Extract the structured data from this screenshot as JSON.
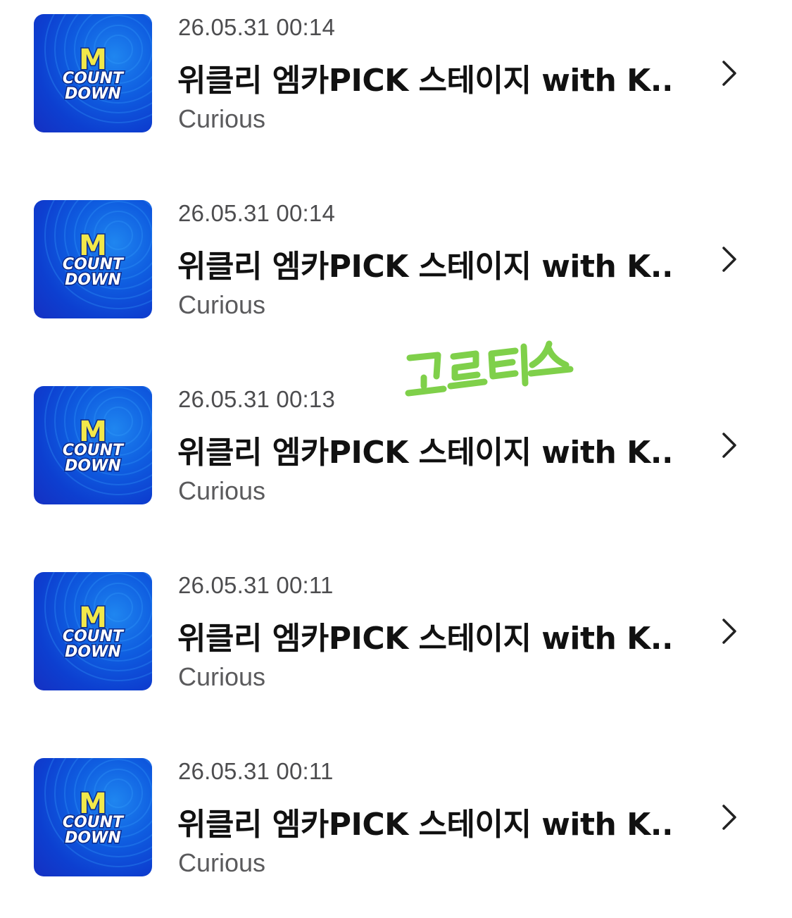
{
  "items": [
    {
      "timestamp": "26.05.31 00:14",
      "title": "위클리 엠카PICK 스테이지 with K...",
      "artist": "Curious",
      "thumbnail": {
        "logo_top": "M",
        "logo_line1": "COUNT",
        "logo_line2": "DOWN"
      }
    },
    {
      "timestamp": "26.05.31 00:14",
      "title": "위클리 엠카PICK 스테이지 with K...",
      "artist": "Curious",
      "thumbnail": {
        "logo_top": "M",
        "logo_line1": "COUNT",
        "logo_line2": "DOWN"
      }
    },
    {
      "timestamp": "26.05.31 00:13",
      "title": "위클리 엠카PICK 스테이지 with K...",
      "artist": "Curious",
      "thumbnail": {
        "logo_top": "M",
        "logo_line1": "COUNT",
        "logo_line2": "DOWN"
      }
    },
    {
      "timestamp": "26.05.31 00:11",
      "title": "위클리 엠카PICK 스테이지 with K...",
      "artist": "Curious",
      "thumbnail": {
        "logo_top": "M",
        "logo_line1": "COUNT",
        "logo_line2": "DOWN"
      }
    },
    {
      "timestamp": "26.05.31 00:11",
      "title": "위클리 엠카PICK 스테이지 with K...",
      "artist": "Curious",
      "thumbnail": {
        "logo_top": "M",
        "logo_line1": "COUNT",
        "logo_line2": "DOWN"
      }
    }
  ],
  "watermark": {
    "text": "코르티스",
    "color": "#7fd04a"
  },
  "colors": {
    "thumb_blue": "#0f5de0",
    "logo_yellow": "#f2e84a",
    "text_primary": "#111111",
    "text_secondary": "#5a5a5c",
    "chevron": "#222222"
  },
  "icons": {
    "row_action": "chevron-right-icon"
  }
}
